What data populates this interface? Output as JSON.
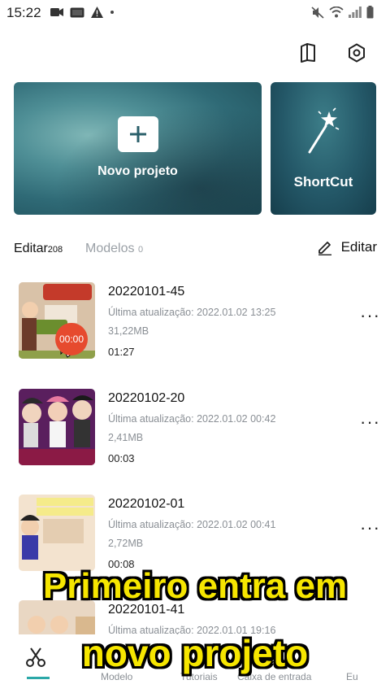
{
  "status_bar": {
    "time": "15:22",
    "left_icons": [
      "video-camera-icon",
      "cc-icon",
      "warning-icon",
      "dot-icon"
    ],
    "right_icons": [
      "mute-icon",
      "wifi-icon",
      "signal-icon",
      "battery-icon"
    ]
  },
  "toolbar": {
    "icons": [
      "book-icon",
      "settings-icon"
    ]
  },
  "cards": {
    "new_project_label": "Novo projeto",
    "shortcut_label": "ShortCut"
  },
  "tabs": {
    "edit_label": "Editar",
    "edit_count": "208",
    "models_label": "Modelos",
    "models_count": "0",
    "edit_action_label": "Editar"
  },
  "projects": [
    {
      "title": "20220101-45",
      "updated": "Última atualização: 2022.01.02 13:25",
      "size": "31,22MB",
      "duration": "01:27",
      "badge": "00:00"
    },
    {
      "title": "20220102-20",
      "updated": "Última atualização: 2022.01.02 00:42",
      "size": "2,41MB",
      "duration": "00:03"
    },
    {
      "title": "20220102-01",
      "updated": "Última atualização: 2022.01.02 00:41",
      "size": "2,72MB",
      "duration": "00:08"
    },
    {
      "title": "20220101-41",
      "updated": "Última atualização: 2022.01.01 19:16",
      "size": "",
      "duration": ""
    }
  ],
  "more_glyph": "···",
  "bottom_nav": {
    "items": [
      "",
      "Modelo",
      "Tutoriais",
      "Caixa de entrada",
      "Eu"
    ],
    "active_icon": "scissors-icon"
  },
  "caption": {
    "line1": "Primeiro entra em",
    "line2": "novo projeto"
  },
  "colors": {
    "accent": "#2ba8a8",
    "caption": "#f6e600",
    "badge": "#e64a2e"
  }
}
